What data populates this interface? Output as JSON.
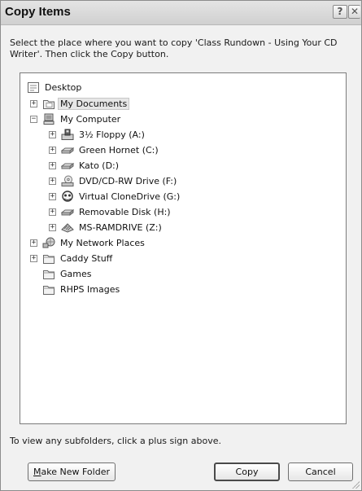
{
  "window": {
    "title": "Copy Items",
    "help_label": "?",
    "close_label": "✕"
  },
  "instructions": "Select the place where you want to copy 'Class Rundown - Using Your CD Writer'. Then click the Copy button.",
  "tree": {
    "items": [
      {
        "label": "Desktop",
        "icon": "desktop-icon",
        "expander": "",
        "selected": false
      },
      {
        "label": "My Documents",
        "icon": "my-documents-folder-icon",
        "expander": "+",
        "selected": true
      },
      {
        "label": "My Computer",
        "icon": "my-computer-icon",
        "expander": "−",
        "selected": false
      },
      {
        "label": "3½ Floppy (A:)",
        "icon": "floppy-drive-icon",
        "expander": "+",
        "selected": false
      },
      {
        "label": "Green Hornet (C:)",
        "icon": "hard-drive-icon",
        "expander": "+",
        "selected": false
      },
      {
        "label": "Kato (D:)",
        "icon": "hard-drive-icon",
        "expander": "+",
        "selected": false
      },
      {
        "label": "DVD/CD-RW Drive (F:)",
        "icon": "cd-drive-icon",
        "expander": "+",
        "selected": false
      },
      {
        "label": "Virtual CloneDrive (G:)",
        "icon": "virtual-drive-icon",
        "expander": "+",
        "selected": false
      },
      {
        "label": "Removable Disk (H:)",
        "icon": "removable-disk-icon",
        "expander": "+",
        "selected": false
      },
      {
        "label": "MS-RAMDRIVE (Z:)",
        "icon": "ram-drive-icon",
        "expander": "+",
        "selected": false
      },
      {
        "label": "My Network Places",
        "icon": "network-places-icon",
        "expander": "+",
        "selected": false
      },
      {
        "label": "Caddy Stuff",
        "icon": "folder-icon",
        "expander": "+",
        "selected": false
      },
      {
        "label": "Games",
        "icon": "folder-icon",
        "expander": "",
        "selected": false
      },
      {
        "label": "RHPS Images",
        "icon": "folder-icon",
        "expander": "",
        "selected": false
      }
    ]
  },
  "hint": "To view any subfolders, click a plus sign above.",
  "buttons": {
    "make_new_folder_accesskey": "M",
    "make_new_folder_rest": "ake New Folder",
    "copy_label": "Copy",
    "cancel_label": "Cancel"
  }
}
